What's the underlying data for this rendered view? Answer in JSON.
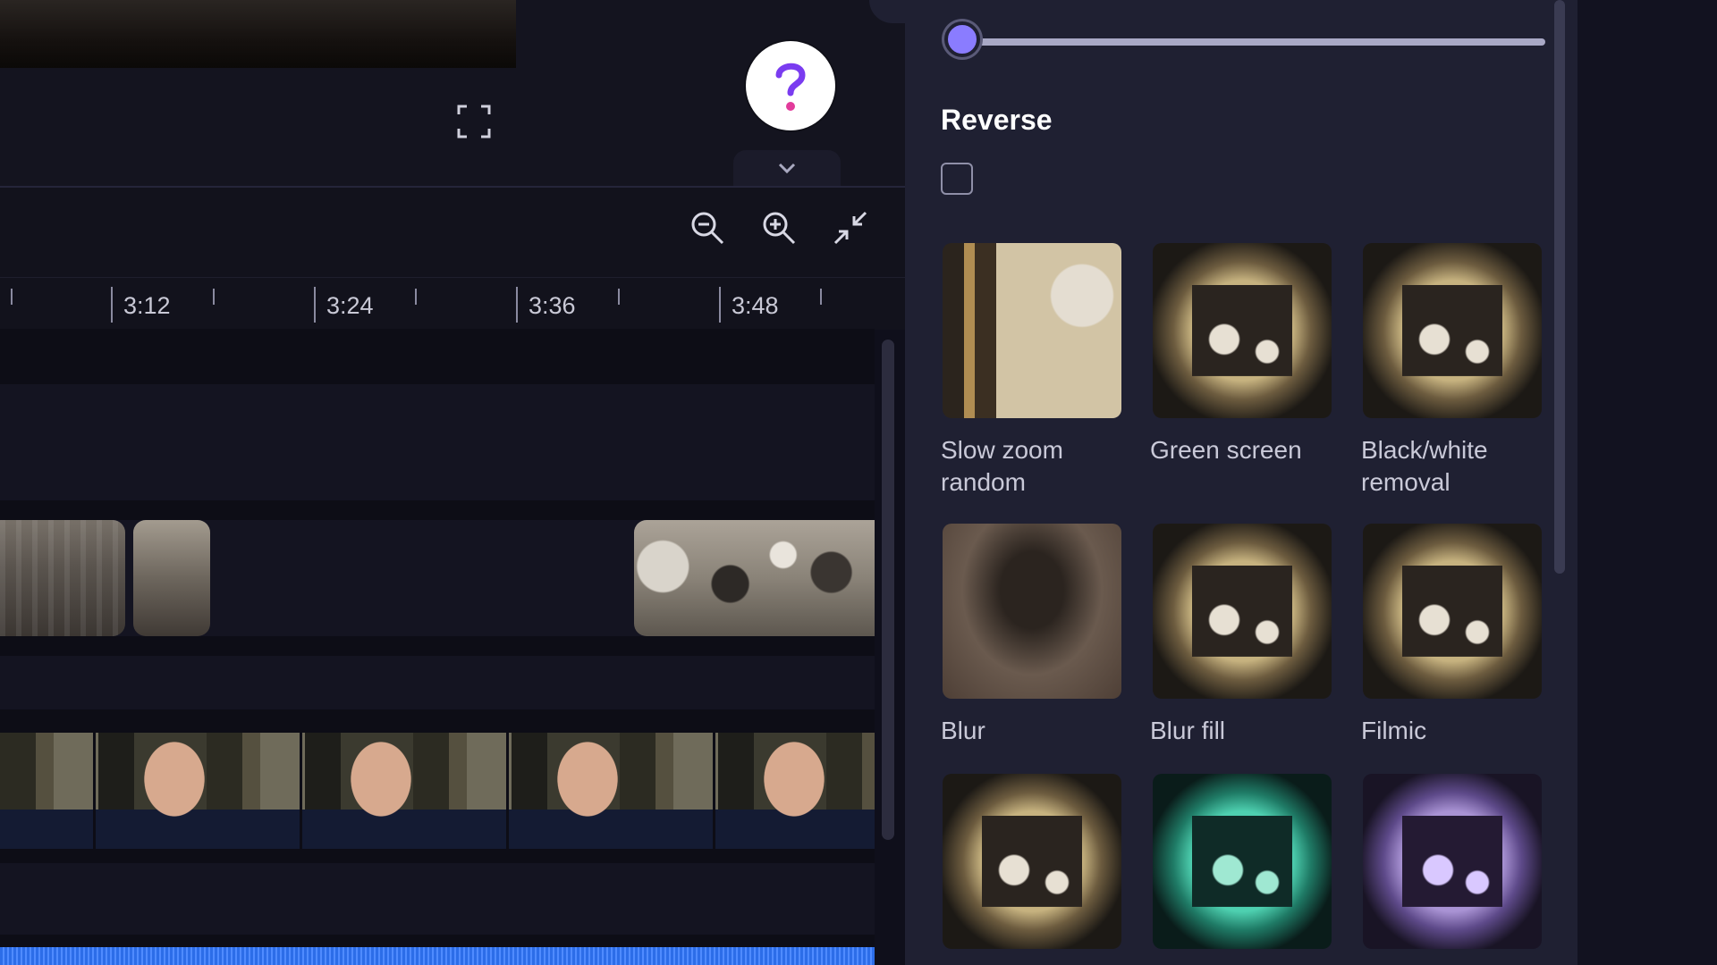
{
  "timeline": {
    "ticks": [
      "3:12",
      "3:24",
      "3:36",
      "3:48"
    ]
  },
  "toolbar": {
    "zoom_out_icon": "zoom-out-icon",
    "zoom_in_icon": "zoom-in-icon",
    "fit_icon": "collapse-arrows-icon",
    "fullscreen_icon": "fullscreen-icon",
    "help_icon": "question-mark-icon",
    "collapse_icon": "chevron-down-icon"
  },
  "panel": {
    "slider_value_fraction": 0,
    "reverse_label": "Reverse",
    "reverse_checked": false,
    "effects": [
      {
        "label": "Slow zoom random"
      },
      {
        "label": "Green screen"
      },
      {
        "label": "Black/white removal"
      },
      {
        "label": "Blur"
      },
      {
        "label": "Blur fill"
      },
      {
        "label": "Filmic"
      },
      {
        "label": ""
      },
      {
        "label": ""
      },
      {
        "label": ""
      }
    ]
  },
  "colors": {
    "accent": "#8a7cff",
    "help_mark": "#7a3cf0",
    "audio": "#2c6de8",
    "panel_bg": "#1f2032"
  }
}
